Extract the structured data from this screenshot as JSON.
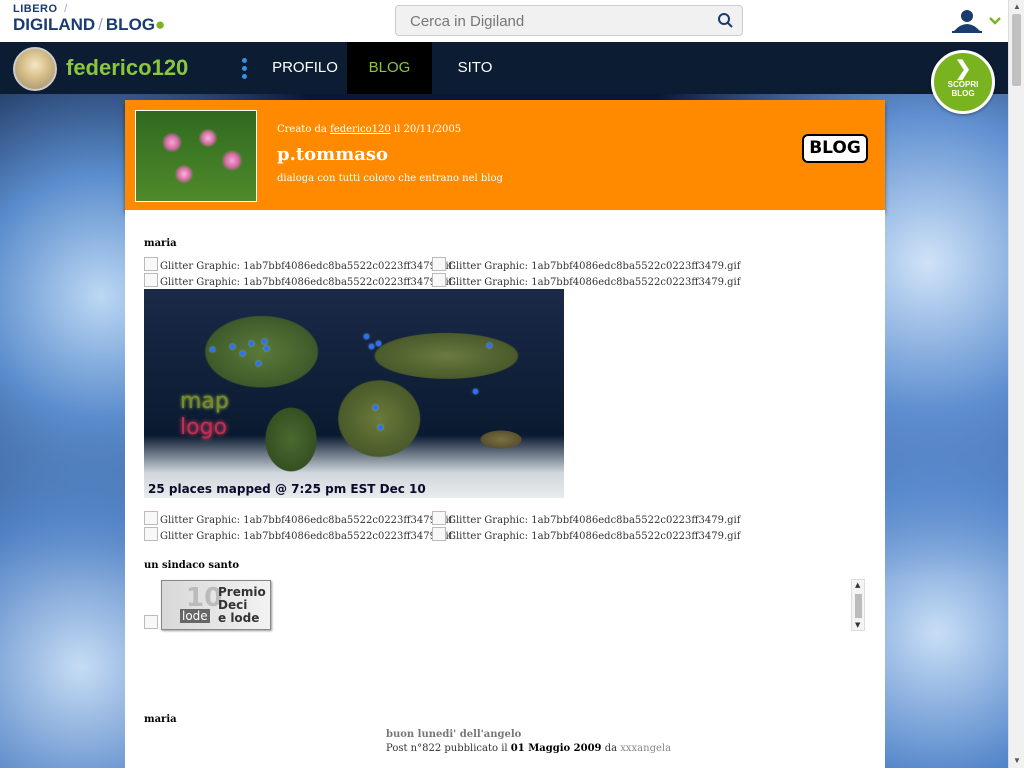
{
  "top": {
    "logo": {
      "line1": "LIBERO",
      "line2a": "DIGILAND",
      "line2b": "BLOG",
      "slash": "/"
    },
    "search": {
      "placeholder": "Cerca in Digiland",
      "icon": "search-icon"
    },
    "user": {
      "icon": "user-icon",
      "chevron": "chevron-down-icon"
    }
  },
  "nav": {
    "username": "federico120",
    "items": [
      {
        "label": "PROFILO",
        "active": false
      },
      {
        "label": "BLOG",
        "active": true
      },
      {
        "label": "SITO",
        "active": false
      }
    ],
    "scopri": {
      "line1": "SCOPRI",
      "line2": "BLOG"
    }
  },
  "blog": {
    "created_prefix": "Creato da",
    "author": "federico120",
    "created_suffix": "il 20/11/2005",
    "title": "p.tommaso",
    "description": "dialoga con tutti coloro che entrano nel blog",
    "badge": "BLOG"
  },
  "content": {
    "section1": "maria",
    "glitter": "Glitter Graphic: 1ab7bbf4086edc8ba5522c0223ff3479.gif",
    "map": {
      "title1": "map",
      "title2": "logo",
      "caption": "25 places mapped @ 7:25 pm EST Dec 10"
    },
    "section2": "un sindaco santo",
    "award": {
      "line1": "Premio",
      "line2": "Deci",
      "line3": "e lode",
      "num": "10",
      "lode": "lode"
    },
    "section3": "maria",
    "post": {
      "title": "buon lunedi' dell'angelo",
      "prefix": "Post n°822 pubblicato il",
      "date": "01 Maggio 2009",
      "da": "da",
      "author": "xxxangela"
    }
  },
  "colors": {
    "accent": "#8cc63f",
    "header": "#ff8a00",
    "nav": "#0c1c32"
  }
}
